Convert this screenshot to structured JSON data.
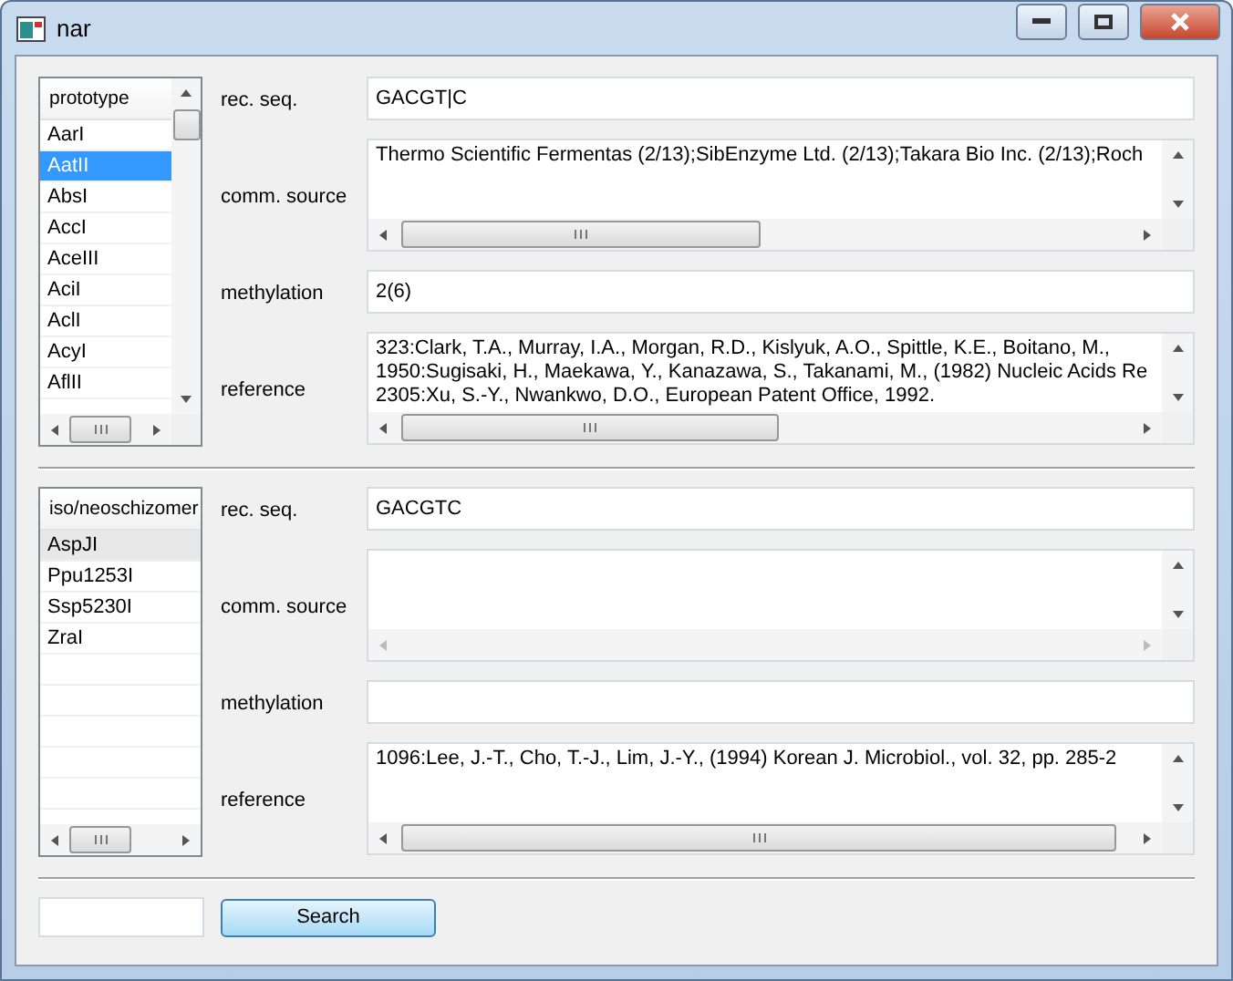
{
  "window": {
    "title": "nar"
  },
  "sections": [
    {
      "list": {
        "header": "prototype",
        "focused": true,
        "items": [
          {
            "label": "AarI",
            "selected": false
          },
          {
            "label": "AatII",
            "selected": true
          },
          {
            "label": "AbsI",
            "selected": false
          },
          {
            "label": "AccI",
            "selected": false
          },
          {
            "label": "AceIII",
            "selected": false
          },
          {
            "label": "AciI",
            "selected": false
          },
          {
            "label": "AclI",
            "selected": false
          },
          {
            "label": "AcyI",
            "selected": false
          },
          {
            "label": "AflII",
            "selected": false
          }
        ]
      },
      "fields": [
        {
          "kind": "line",
          "label": "rec. seq.",
          "value": "GACGT|C"
        },
        {
          "kind": "area",
          "label": "comm. source",
          "lines": [
            "Thermo Scientific Fermentas (2/13);SibEnzyme Ltd. (2/13);Takara Bio Inc. (2/13);Roch"
          ]
        },
        {
          "kind": "line",
          "label": "methylation",
          "value": "2(6)"
        },
        {
          "kind": "area",
          "label": "reference",
          "lines": [
            "323:Clark, T.A., Murray, I.A., Morgan, R.D., Kislyuk, A.O., Spittle, K.E., Boitano, M., ",
            "1950:Sugisaki, H., Maekawa, Y., Kanazawa, S., Takanami, M., (1982) Nucleic Acids Re",
            "2305:Xu, S.-Y., Nwankwo, D.O., European Patent Office, 1992."
          ]
        }
      ]
    },
    {
      "list": {
        "header": "iso/neoschizomer",
        "focused": false,
        "items": [
          {
            "label": "AspJI",
            "selected": true
          },
          {
            "label": "Ppu1253I",
            "selected": false
          },
          {
            "label": "Ssp5230I",
            "selected": false
          },
          {
            "label": "ZraI",
            "selected": false
          }
        ]
      },
      "fields": [
        {
          "kind": "line",
          "label": "rec. seq.",
          "value": "GACGTC"
        },
        {
          "kind": "area",
          "label": "comm. source"
        },
        {
          "kind": "line",
          "label": "methylation"
        },
        {
          "kind": "area",
          "label": "reference",
          "lines": [
            "1096:Lee, J.-T., Cho, T.-J., Lim, J.-Y., (1994) Korean J. Microbiol., vol. 32, pp. 285-2"
          ]
        }
      ]
    }
  ],
  "search": {
    "button": "Search"
  }
}
